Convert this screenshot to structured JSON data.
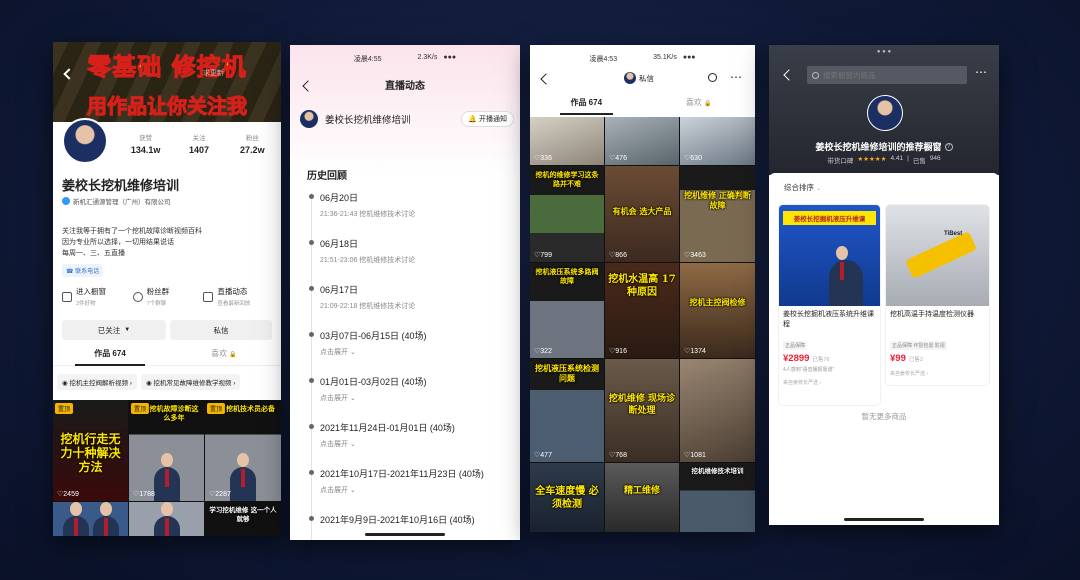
{
  "p1": {
    "banner": {
      "line1": "零基础 修挖机",
      "line2": "用作品让你关注我",
      "faded_text": "求更新"
    },
    "stats": [
      {
        "label": "获赞",
        "value": "134.1w"
      },
      {
        "label": "关注",
        "value": "1407"
      },
      {
        "label": "粉丝",
        "value": "27.2w"
      }
    ],
    "name": "姜校长挖机维修培训",
    "verified": "新机汇通源管理（广州）有限公司",
    "bio": [
      "关注我等于拥有了一个挖机故障诊断视频百科",
      "因为专业所以选择，一切用结果说话",
      "每周一、三、五直播"
    ],
    "contact": "联系电话",
    "services": [
      {
        "title": "进入橱窗",
        "sub": "2件好物",
        "icon": "bag-icon"
      },
      {
        "title": "粉丝群",
        "sub": "7个群聊",
        "icon": "group-icon"
      },
      {
        "title": "直播动态",
        "sub": "查看最新回放",
        "icon": "live-icon"
      }
    ],
    "followed": "已关注",
    "message": "私信",
    "tabs": [
      {
        "label": "作品 674"
      },
      {
        "label": "喜欢"
      }
    ],
    "collections": [
      {
        "label": "挖机主控阀解析视频"
      },
      {
        "label": "挖机常见故障维修教学视频"
      }
    ],
    "videos": [
      {
        "tag": "置顶",
        "caption": "挖机行走无力十种解决方法",
        "likes": "2459"
      },
      {
        "tag": "置顶",
        "caption": "挖机故障诊断这么多年",
        "likes": "1788"
      },
      {
        "tag": "置顶",
        "caption": "挖机技术员必备",
        "likes": "2287"
      },
      {
        "caption": "",
        "likes": ""
      },
      {
        "caption": "",
        "likes": ""
      },
      {
        "caption": "学习挖机维修 这一个人就够",
        "likes": ""
      }
    ]
  },
  "p2": {
    "time": "凌晨4:55",
    "net": "2.3K/s",
    "title": "直播动态",
    "account": "姜校长挖机维修培训",
    "notify": "开播通知",
    "section": "历史回顾",
    "entries": [
      {
        "date": "06月20日",
        "detail": "21:36-21:43  挖机维修技术讨论"
      },
      {
        "date": "06月18日",
        "detail": "21:51-23:06  挖机维修技术讨论"
      },
      {
        "date": "06月17日",
        "detail": "21:09-22:18  挖机维修技术讨论"
      },
      {
        "date": "03月07日-06月15日 (40场)",
        "detail": "点击展开"
      },
      {
        "date": "01月01日-03月02日 (40场)",
        "detail": "点击展开"
      },
      {
        "date": "2021年11月24日-01月01日 (40场)",
        "detail": "点击展开"
      },
      {
        "date": "2021年10月17日-2021年11月23日 (40场)",
        "detail": "点击展开"
      },
      {
        "date": "2021年9月9日-2021年10月16日 (40场)",
        "detail": "点击展开"
      }
    ]
  },
  "p3": {
    "time": "凌晨4:53",
    "net": "35.1K/s",
    "header_label": "私信",
    "tabs": [
      {
        "label": "作品 674"
      },
      {
        "label": "喜欢"
      }
    ],
    "videos": [
      {
        "caption": "",
        "likes": "336"
      },
      {
        "caption": "",
        "likes": "476"
      },
      {
        "caption": "",
        "likes": "630"
      },
      {
        "caption": "挖机的维修学习这条路并不难",
        "likes": "799"
      },
      {
        "caption": "有机会 选大产品",
        "likes": "866"
      },
      {
        "caption": "挖机维修 正确判断故障",
        "likes": "3463"
      },
      {
        "caption": "挖机液压系统多路阀故障",
        "likes": "322"
      },
      {
        "caption": "挖机水温高 17种原因",
        "likes": "916"
      },
      {
        "caption": "挖机主控阀检修",
        "likes": "1374"
      },
      {
        "caption": "挖机液压系统检测问题",
        "likes": "477"
      },
      {
        "caption": "挖机维修 现场诊断处理",
        "likes": "768"
      },
      {
        "caption": "",
        "likes": "1081"
      },
      {
        "caption": "全车速度慢 必须检测",
        "likes": ""
      },
      {
        "caption": "精工维修",
        "likes": ""
      },
      {
        "caption": "挖机维修技术培训",
        "likes": ""
      }
    ]
  },
  "p4": {
    "search_placeholder": "搜索橱窗内商品",
    "title": "姜校长挖机维修培训的推荐橱窗",
    "rating_label": "带货口碑",
    "stars": "★★★★★",
    "rating": "4.41",
    "sold_label": "已售",
    "sold": "946",
    "sort": "综合排序",
    "products": [
      {
        "thumb": "姜校长挖掘机液压升维课",
        "title": "姜校长挖掘机液压系统升维课程",
        "badge": "正品保障",
        "price": "¥2899",
        "sold": "已售76",
        "note": "4人感到“语音播报靠谱”",
        "link": "来自姜校长严选"
      },
      {
        "thumb": "TiBest",
        "title": "挖机高温手持温度检测仪器",
        "badge": "正品保障  坏损包退  影视",
        "price": "¥99",
        "sold": "已售2",
        "note": "",
        "link": "来自姜校长严选"
      }
    ],
    "empty": "暂无更多商品"
  },
  "colors": {
    "accent_red": "#fe2c55",
    "price_red": "#ee1d35",
    "gold": "#f5b400",
    "banner_red": "#d62019",
    "caption_yellow": "#ffe600"
  }
}
